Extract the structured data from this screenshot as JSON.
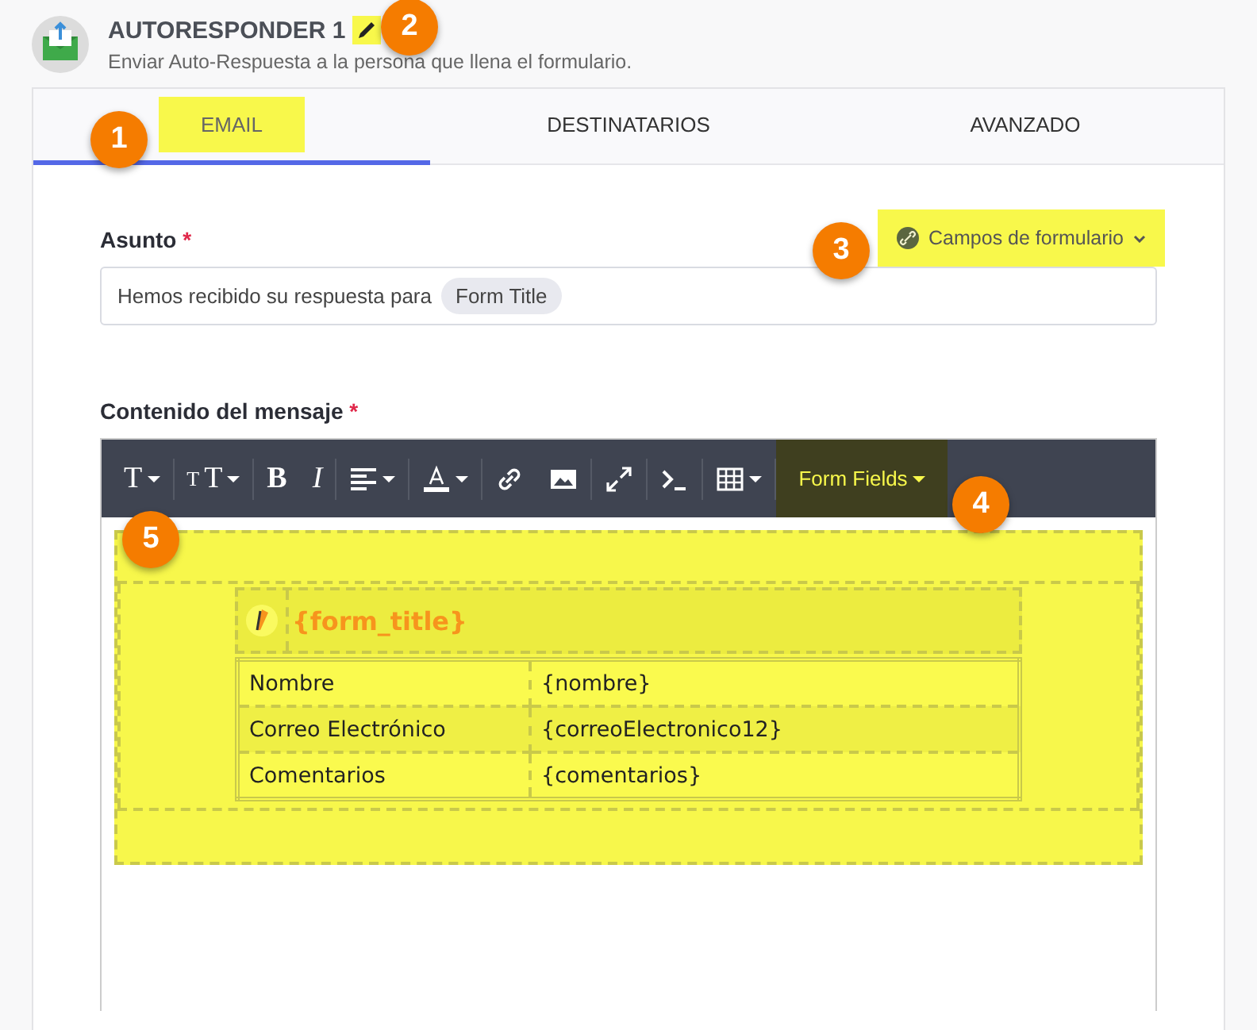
{
  "header": {
    "title": "AUTORESPONDER 1",
    "edit_highlighted": true,
    "subtitle": "Enviar Auto-Respuesta a la persona que llena el formulario."
  },
  "tabs": [
    {
      "label": "EMAIL",
      "selected": true,
      "highlighted": true
    },
    {
      "label": "DESTINATARIOS",
      "selected": false,
      "highlighted": false
    },
    {
      "label": "AVANZADO",
      "selected": false,
      "highlighted": false
    }
  ],
  "subject": {
    "label": "Asunto",
    "required": "*",
    "value": "Hemos recibido su respuesta para",
    "token": "Form Title",
    "fields_button": {
      "label": "Campos de formulario",
      "highlighted": true
    }
  },
  "message": {
    "label": "Contenido del mensaje",
    "required": "*",
    "toolbar": [
      {
        "kind": "font",
        "label": "T",
        "caret": true
      },
      {
        "kind": "separator"
      },
      {
        "kind": "size",
        "small": "T",
        "label": "T",
        "caret": true
      },
      {
        "kind": "separator"
      },
      {
        "kind": "bold",
        "label": "B"
      },
      {
        "kind": "italic",
        "label": "I"
      },
      {
        "kind": "separator"
      },
      {
        "kind": "align",
        "caret": true
      },
      {
        "kind": "separator"
      },
      {
        "kind": "color",
        "caret": true
      },
      {
        "kind": "separator"
      },
      {
        "kind": "link"
      },
      {
        "kind": "image"
      },
      {
        "kind": "separator"
      },
      {
        "kind": "fullscreen"
      },
      {
        "kind": "separator"
      },
      {
        "kind": "code"
      },
      {
        "kind": "separator"
      },
      {
        "kind": "table",
        "caret": true
      },
      {
        "kind": "separator"
      },
      {
        "kind": "fields",
        "label": "Form Fields",
        "caret": true,
        "highlighted": true
      }
    ],
    "content": {
      "title": "{form_title}",
      "rows": [
        {
          "name": "Nombre",
          "value": "{nombre}"
        },
        {
          "name": "Correo Electrónico",
          "value": "{correoElectronico12}"
        },
        {
          "name": "Comentarios",
          "value": "{comentarios}"
        }
      ]
    }
  },
  "callouts": [
    {
      "number": "1"
    },
    {
      "number": "2"
    },
    {
      "number": "3"
    },
    {
      "number": "4"
    },
    {
      "number": "5"
    }
  ]
}
